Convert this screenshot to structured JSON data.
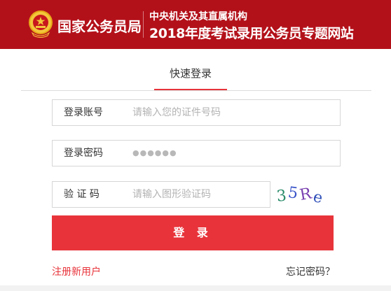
{
  "header": {
    "org_name": "国家公务员局",
    "subtitle_line1": "中央机关及其直属机构",
    "subtitle_line2": "2018年度考试录用公务员专题网站"
  },
  "tabs": [
    {
      "label": "快速登录",
      "active": true
    }
  ],
  "form": {
    "account": {
      "label": "登录账号",
      "placeholder": "请输入您的证件号码"
    },
    "password": {
      "label": "登录密码",
      "value_masked": "●●●●●●"
    },
    "captcha": {
      "label": "验 证 码",
      "placeholder": "请输入图形验证码",
      "image_text": "35Re"
    }
  },
  "actions": {
    "login_label": "登 录",
    "register_label": "注册新用户",
    "forgot_label": "忘记密码？"
  },
  "colors": {
    "header_bg": "#b3111a",
    "accent": "#e8333a"
  }
}
